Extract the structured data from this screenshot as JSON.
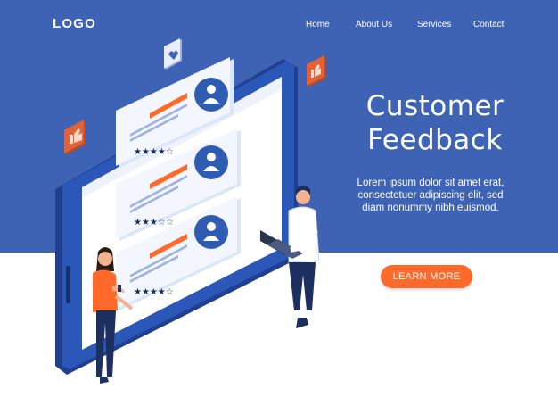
{
  "header": {
    "logo": "LOGO",
    "nav": [
      {
        "label": "Home"
      },
      {
        "label": "About Us"
      },
      {
        "label": "Services"
      },
      {
        "label": "Contact"
      }
    ]
  },
  "hero": {
    "title_line1": "Customer",
    "title_line2": "Feedback",
    "body_line1": "Lorem ipsum dolor sit amet erat,",
    "body_line2": "consectetuer adipiscing elit, sed",
    "body_line3": "diam nonummy nibh euismod.",
    "cta_label": "LEARN MORE"
  },
  "illustration": {
    "review_cards": [
      {
        "stars_filled": 4,
        "stars_total": 5
      },
      {
        "stars_filled": 3,
        "stars_total": 5
      },
      {
        "stars_filled": 4,
        "stars_total": 5
      }
    ],
    "floating_icons": [
      "heart-icon",
      "thumbs-up-icon",
      "thumbs-up-icon"
    ]
  },
  "colors": {
    "band": "#3f63b4",
    "accent": "#ff6a2b",
    "tablet_frame": "#2b4fa3",
    "card": "#e9f0fb",
    "avatar": "#2f5cb3"
  }
}
